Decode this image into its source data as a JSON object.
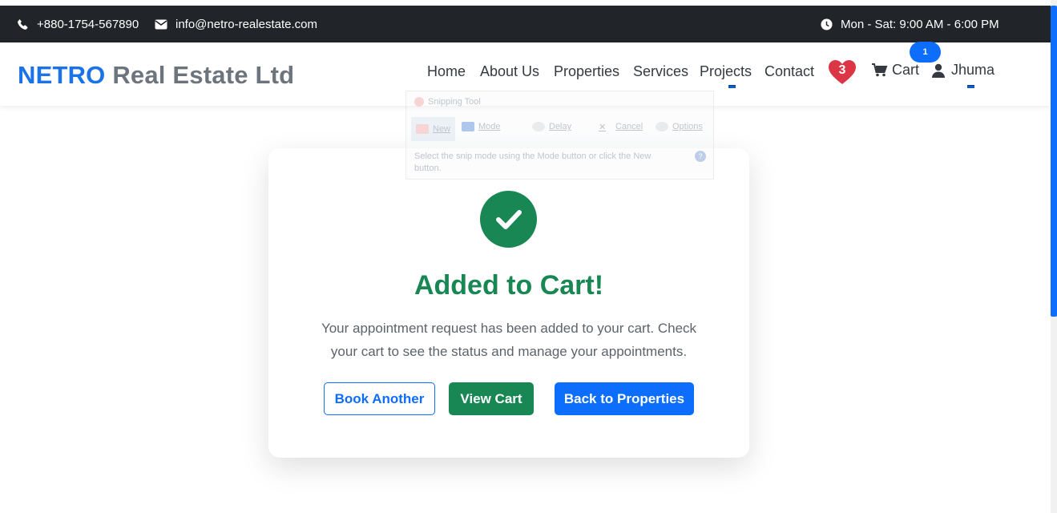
{
  "topbar": {
    "phone": "+880-1754-567890",
    "email": "info@netro-realestate.com",
    "hours": "Mon - Sat: 9:00 AM - 6:00 PM",
    "icons": [
      "phone-icon",
      "envelope-icon",
      "clock-icon"
    ]
  },
  "navbar": {
    "brand_primary": "NETRO",
    "brand_secondary": "Real Estate Ltd",
    "links": [
      "Home",
      "About Us",
      "Properties",
      "Services",
      "Projects",
      "Contact"
    ],
    "favorites_count": "3",
    "cart_label": "Cart",
    "cart_count": "1",
    "user_name": "Jhuma"
  },
  "snipping_tool": {
    "title": "Snipping Tool",
    "new_label": "New",
    "mode_label": "Mode",
    "delay_label": "Delay",
    "cancel_label": "Cancel",
    "options_label": "Options",
    "hint": "Select the snip mode using the Mode button or click the New button.",
    "help": "?"
  },
  "confirmation": {
    "heading": "Added to Cart!",
    "message": "Your appointment request has been added to your cart. Check your cart to see the status and manage your appointments.",
    "book_another": "Book Another",
    "view_cart": "View Cart",
    "back_to_properties": "Back to Properties"
  },
  "colors": {
    "topbar_bg": "#212529",
    "brand_blue": "#1a73e8",
    "success_green": "#198754",
    "primary_blue": "#0d6efd",
    "heart_red": "#dc3545"
  }
}
